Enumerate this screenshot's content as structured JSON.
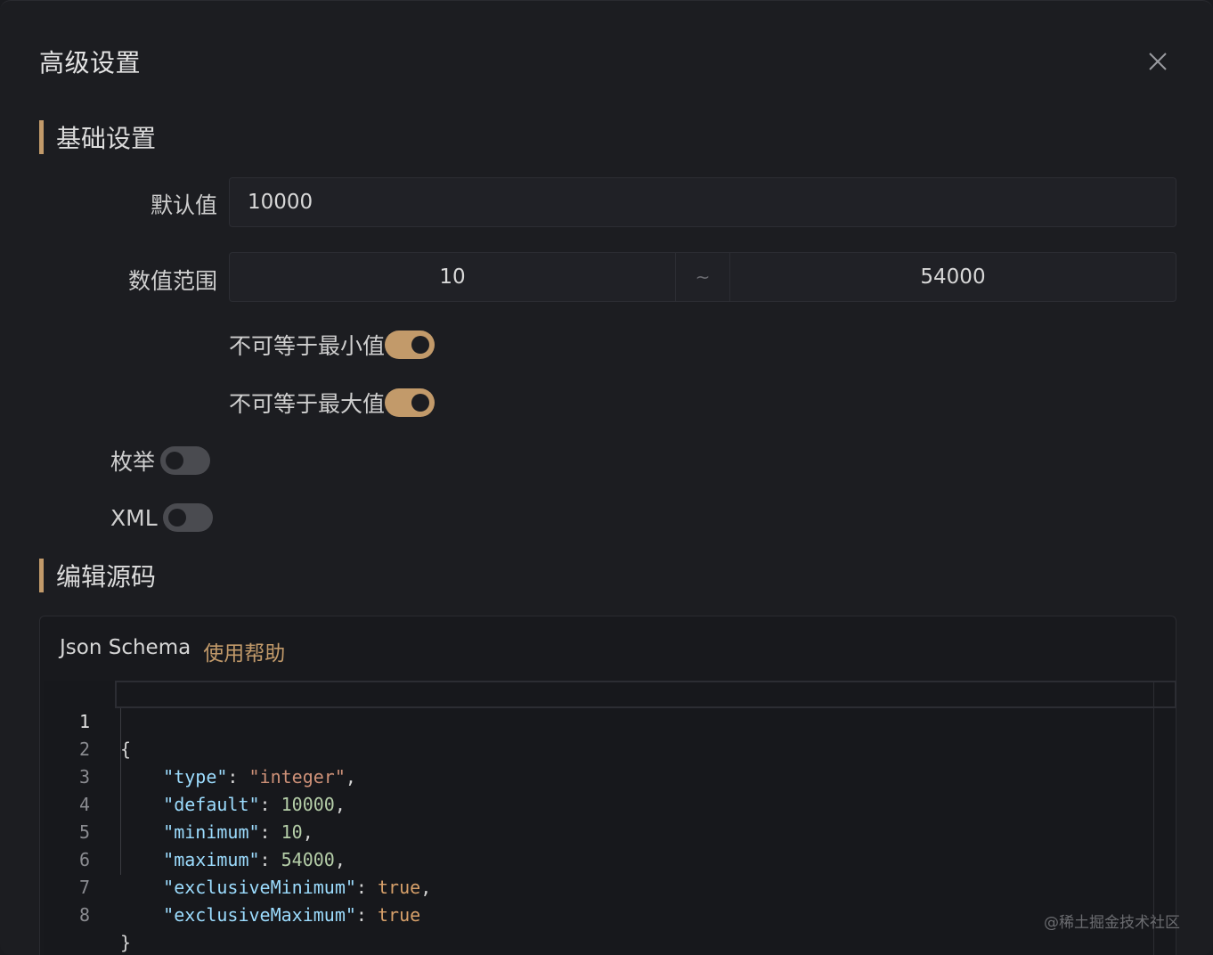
{
  "dialog": {
    "title": "高级设置",
    "close_label": "close"
  },
  "basic_section": {
    "title": "基础设置",
    "default_label": "默认值",
    "default_value": "10000",
    "range_label": "数值范围",
    "range_min": "10",
    "range_sep": "~",
    "range_max": "54000",
    "exclusive_min_label": "不可等于最小值",
    "exclusive_min_on": true,
    "exclusive_max_label": "不可等于最大值",
    "exclusive_max_on": true,
    "enum_label": "枚举",
    "enum_on": false,
    "xml_label": "XML",
    "xml_on": false
  },
  "source_section": {
    "title": "编辑源码",
    "schema_title": "Json Schema",
    "help_link": "使用帮助",
    "line_numbers": [
      "1",
      "2",
      "3",
      "4",
      "5",
      "6",
      "7",
      "8"
    ],
    "code": {
      "l1": "{",
      "l2_key": "\"type\"",
      "l2_val": "\"integer\"",
      "l3_key": "\"default\"",
      "l3_val": "10000",
      "l4_key": "\"minimum\"",
      "l4_val": "10",
      "l5_key": "\"maximum\"",
      "l5_val": "54000",
      "l6_key": "\"exclusiveMinimum\"",
      "l6_val": "true",
      "l7_key": "\"exclusiveMaximum\"",
      "l7_val": "true",
      "l8": "}"
    }
  },
  "watermark": "@稀土掘金技术社区",
  "colors": {
    "accent": "#c29a6a",
    "background": "#1c1d21"
  }
}
